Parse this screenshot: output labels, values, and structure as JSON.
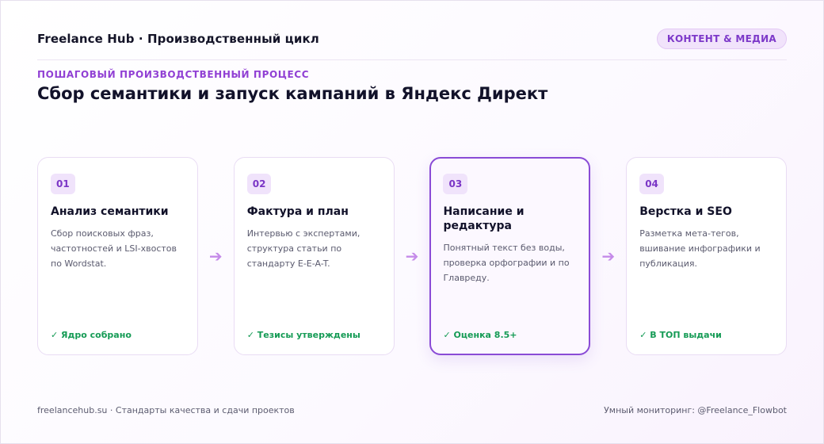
{
  "header": {
    "brand": "Freelance Hub · Производственный цикл",
    "badge": "КОНТЕНТ & МЕДИА"
  },
  "eyebrow": "ПОШАГОВЫЙ ПРОИЗВОДСТВЕННЫЙ ПРОЦЕСС",
  "title": "Сбор семантики и запуск кампаний в Яндекс Директ",
  "arrow_icon": "➔",
  "steps": [
    {
      "num": "01",
      "title": "Анализ семантики",
      "desc": "Сбор поисковых фраз, частотностей и LSI-хвостов по Wordstat.",
      "status": "✓ Ядро собрано"
    },
    {
      "num": "02",
      "title": "Фактура и план",
      "desc": "Интервью с экспертами, структура статьи по стандарту E-E-A-T.",
      "status": "✓ Тезисы утверждены"
    },
    {
      "num": "03",
      "title": "Написание и редактура",
      "desc": "Понятный текст без воды, проверка орфографии и по Главреду.",
      "status": "✓ Оценка 8.5+",
      "active": true
    },
    {
      "num": "04",
      "title": "Верстка и SEO",
      "desc": "Разметка мета-тегов, вшивание инфографики и публикация.",
      "status": "✓ В ТОП выдачи"
    }
  ],
  "footer": {
    "left": "freelancehub.su · Стандарты качества и сдачи проектов",
    "right": "Умный мониторинг: @Freelance_Flowbot"
  },
  "colors": {
    "accent": "#8a4bd6",
    "eyebrow": "#9140d4",
    "status_ok": "#159b55",
    "arrow": "#c58be9"
  }
}
